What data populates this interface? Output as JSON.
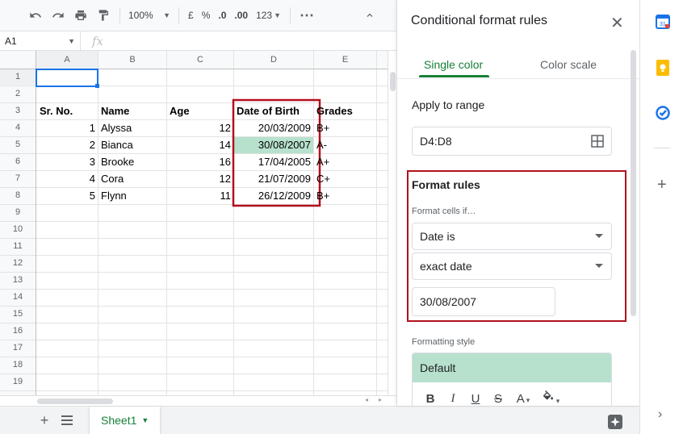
{
  "toolbar": {
    "undo_icon": "undo-icon",
    "redo_icon": "redo-icon",
    "print_icon": "print-icon",
    "paint_format_icon": "paint-format-icon",
    "zoom": "100%",
    "currency": "£",
    "percent": "%",
    "decrease_decimal": ".0",
    "increase_decimal": ".00",
    "more_formats": "123",
    "more_icon": "more-horizontal-icon",
    "collapse_icon": "chevron-up-icon"
  },
  "formula_bar": {
    "cell_ref": "A1",
    "fx": "fx",
    "value": ""
  },
  "grid": {
    "columns": [
      "A",
      "B",
      "C",
      "D",
      "E"
    ],
    "rows": [
      "1",
      "2",
      "3",
      "4",
      "5",
      "6",
      "7",
      "8",
      "9",
      "10",
      "11",
      "12",
      "13",
      "14",
      "15",
      "16",
      "17",
      "18",
      "19"
    ],
    "header_row": {
      "sr": "Sr. No.",
      "name": "Name",
      "age": "Age",
      "dob": "Date of Birth",
      "grades": "Grades"
    },
    "records": [
      {
        "sr": "1",
        "name": "Alyssa",
        "age": "12",
        "dob": "20/03/2009",
        "grade": "B+"
      },
      {
        "sr": "2",
        "name": "Bianca",
        "age": "14",
        "dob": "30/08/2007",
        "grade": "A-"
      },
      {
        "sr": "3",
        "name": "Brooke",
        "age": "16",
        "dob": "17/04/2005",
        "grade": "A+"
      },
      {
        "sr": "4",
        "name": "Cora",
        "age": "12",
        "dob": "21/07/2009",
        "grade": "C+"
      },
      {
        "sr": "5",
        "name": "Flynn",
        "age": "11",
        "dob": "26/12/2009",
        "grade": "B+"
      }
    ],
    "highlight_color": "#b7e1cd",
    "annotation_color": "#b3101f"
  },
  "sheet_tabs": {
    "add_icon": "plus-icon",
    "all_sheets_icon": "menu-lines-icon",
    "active_sheet": "Sheet1",
    "explore_icon": "explore-icon"
  },
  "panel": {
    "title": "Conditional format rules",
    "close_icon": "close-icon",
    "tabs": [
      "Single color",
      "Color scale"
    ],
    "apply_to_range_label": "Apply to range",
    "range_value": "D4:D8",
    "range_icon": "grid-select-icon",
    "format_rules_label": "Format rules",
    "format_cells_if_label": "Format cells if…",
    "condition": "Date is",
    "date_mode": "exact date",
    "date_value": "30/08/2007",
    "formatting_style_label": "Formatting style",
    "style_preset": "Default",
    "style_buttons": [
      "B",
      "I",
      "U",
      "S",
      "A"
    ],
    "accent_color": "#188038"
  },
  "rail": {
    "items": [
      "calendar-icon",
      "keep-icon",
      "tasks-icon"
    ],
    "add_icon": "plus-icon",
    "expand_icon": "chevron-right-icon"
  }
}
